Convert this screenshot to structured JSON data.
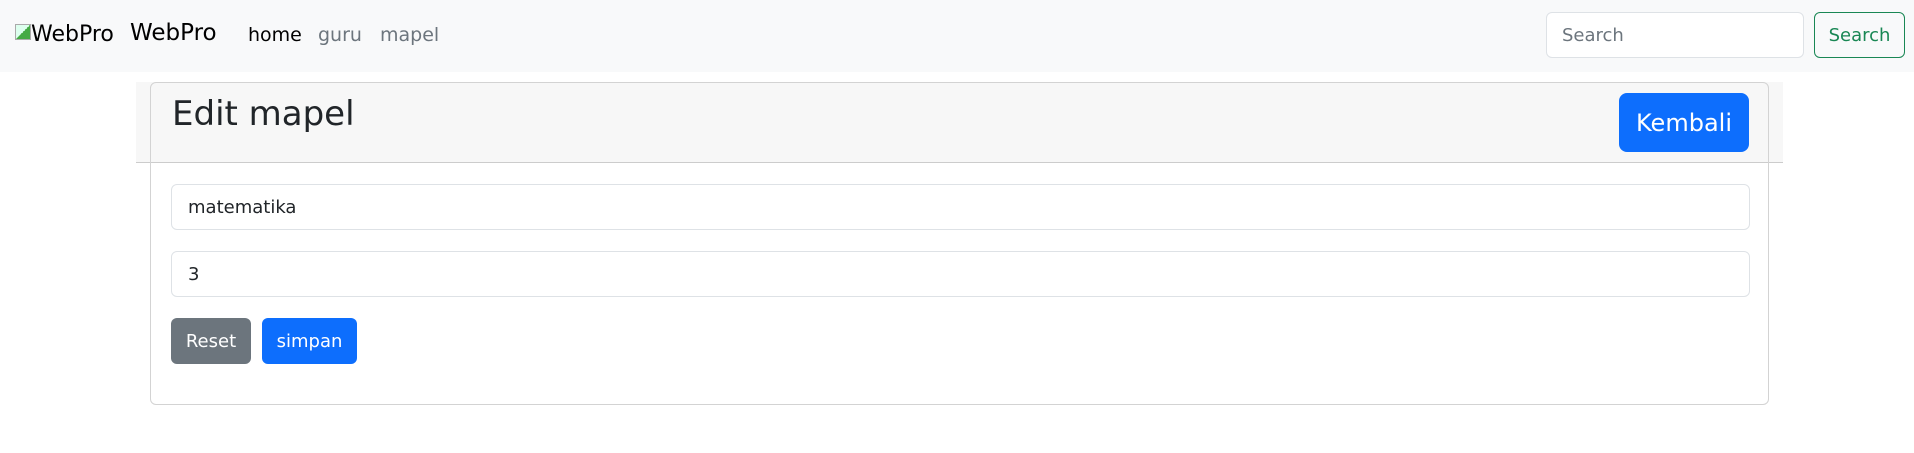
{
  "navbar": {
    "logo_alt": "WebPro",
    "brand": "WebPro",
    "links": [
      {
        "label": "home",
        "active": true
      },
      {
        "label": "guru",
        "active": false
      },
      {
        "label": "mapel",
        "active": false
      }
    ],
    "search_placeholder": "Search",
    "search_button": "Search"
  },
  "card": {
    "title": "Edit mapel",
    "back_button": "Kembali",
    "fields": [
      {
        "value": "matematika"
      },
      {
        "value": "3"
      }
    ],
    "reset_button": "Reset",
    "save_button": "simpan"
  },
  "colors": {
    "primary": "#0d6efd",
    "secondary": "#6c757d",
    "success": "#198754"
  }
}
